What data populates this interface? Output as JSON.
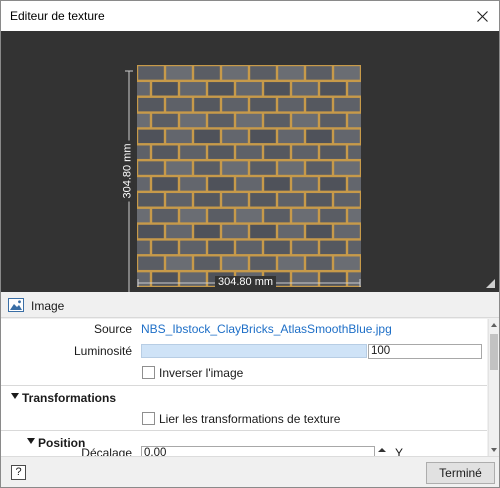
{
  "window": {
    "title": "Editeur de texture"
  },
  "preview": {
    "height_dimension": "304.80 mm",
    "width_dimension": "304.80 mm",
    "texture": "brick-texture",
    "colors": {
      "background": "#333333",
      "brick": "#5c5f66",
      "mortar": "#c79a4a"
    }
  },
  "image_section": {
    "title": "Image",
    "icon": "image-icon",
    "source_label": "Source",
    "source_value": "NBS_Ibstock_ClayBricks_AtlasSmoothBlue.jpg",
    "brightness_label": "Luminosité",
    "brightness_value": "100",
    "invert_label": "Inverser l'image",
    "invert_checked": false
  },
  "transformations": {
    "title": "Transformations",
    "link_label": "Lier les transformations de texture",
    "link_checked": false,
    "position": {
      "title": "Position",
      "offset_label": "Décalage",
      "offset_value": "0.00",
      "axis": "Y"
    }
  },
  "footer": {
    "help_label": "?",
    "done_label": "Terminé"
  },
  "accent_colors": {
    "link": "#1e6fc7",
    "slider": "#cfe3f7"
  }
}
